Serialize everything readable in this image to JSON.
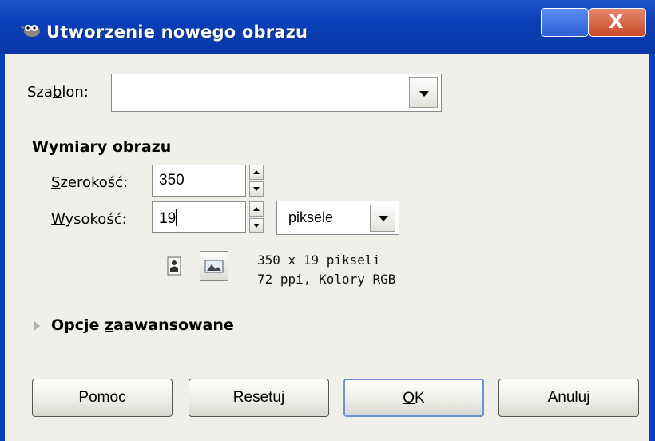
{
  "window": {
    "title": "Utworzenie nowego obrazu",
    "close_label": "X"
  },
  "template": {
    "label_pre": "Sza",
    "label_mn": "b",
    "label_post": "lon:",
    "value": ""
  },
  "dimensions": {
    "section_title": "Wymiary obrazu",
    "width_label_mn": "S",
    "width_label_post": "zerokość:",
    "width_value": "350",
    "height_label_mn": "W",
    "height_label_post": "ysokość:",
    "height_value": "19",
    "unit": "piksele",
    "info_size": "350 x 19 pikseli",
    "info_res": "72 ppi, Kolory RGB"
  },
  "advanced": {
    "label_pre": "Opcje ",
    "label_mn": "z",
    "label_post": "aawansowane"
  },
  "buttons": {
    "help_pre": "Pomo",
    "help_mn": "c",
    "reset_mn": "R",
    "reset_post": "esetuj",
    "ok_mn": "O",
    "ok_post": "K",
    "cancel_mn": "A",
    "cancel_post": "nuluj"
  },
  "colors": {
    "titlebar": "#0a3fb8",
    "dialog_bg": "#f0efe9",
    "close_button": "#c94b2b",
    "default_button_border": "#6f91d9"
  }
}
